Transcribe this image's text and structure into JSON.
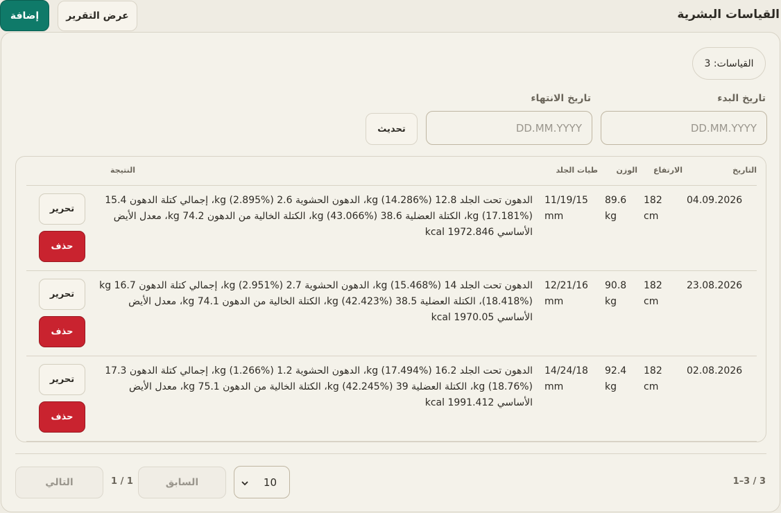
{
  "header": {
    "title": "القياسات البشرية",
    "add_label": "إضافة",
    "report_label": "عرض التقرير"
  },
  "summary": {
    "count_label": "القياسات: 3"
  },
  "filters": {
    "start_label": "تاريخ البدء",
    "end_label": "تاريخ الانتهاء",
    "start_placeholder": "DD.MM.YYYY",
    "end_placeholder": "DD.MM.YYYY",
    "refresh_label": "تحديث"
  },
  "table": {
    "columns": {
      "date": "التاريخ",
      "height": "الارتفاع",
      "weight": "الوزن",
      "skinfolds": "طيات الجلد",
      "result": "النتيجة"
    },
    "rows": [
      {
        "date": "04.09.2026",
        "height": "182 cm",
        "weight": "89.6 kg",
        "skinfolds": "11/19/15 mm",
        "result": "الدهون تحت الجلد 12.8 kg (14.286%)، الدهون الحشوية 2.6 kg (2.895%)، إجمالي كتلة الدهون 15.4 kg (17.181%)، الكتلة العضلية 38.6 kg (43.066%)، الكتلة الخالية من الدهون 74.2 kg، معدل الأيض الأساسي 1972.846 kcal",
        "edit_label": "تحرير",
        "delete_label": "حذف"
      },
      {
        "date": "23.08.2026",
        "height": "182 cm",
        "weight": "90.8 kg",
        "skinfolds": "12/21/16 mm",
        "result": "الدهون تحت الجلد 14 kg (15.468%)، الدهون الحشوية 2.7 kg (2.951%)، إجمالي كتلة الدهون 16.7 kg (18.418%)، الكتلة العضلية 38.5 kg (42.423%)، الكتلة الخالية من الدهون 74.1 kg، معدل الأيض الأساسي 1970.05 kcal",
        "edit_label": "تحرير",
        "delete_label": "حذف"
      },
      {
        "date": "02.08.2026",
        "height": "182 cm",
        "weight": "92.4 kg",
        "skinfolds": "14/24/18 mm",
        "result": "الدهون تحت الجلد 16.2 kg (17.494%)، الدهون الحشوية 1.2 kg (1.266%)، إجمالي كتلة الدهون 17.3 kg (18.76%)، الكتلة العضلية 39 kg (42.245%)، الكتلة الخالية من الدهون 75.1 kg، معدل الأيض الأساسي 1991.412 kcal",
        "edit_label": "تحرير",
        "delete_label": "حذف"
      }
    ]
  },
  "pagination": {
    "range_text": "1–3 / 3",
    "page_size": "10",
    "prev_label": "السابق",
    "page_indicator": "1 / 1",
    "next_label": "التالي"
  },
  "icons": {
    "page_size_dropdown": "chevron-down-icon"
  }
}
